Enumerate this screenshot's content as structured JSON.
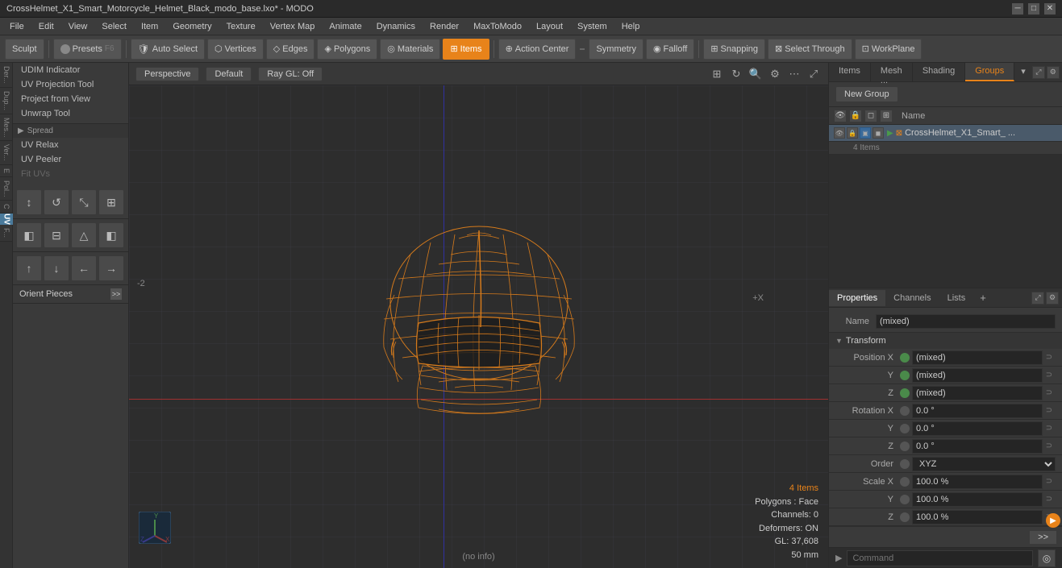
{
  "titlebar": {
    "title": "CrossHelmet_X1_Smart_Motorcycle_Helmet_Black_modo_base.lxo* - MODO",
    "controls": [
      "─",
      "□",
      "✕"
    ]
  },
  "menubar": {
    "items": [
      "File",
      "Edit",
      "View",
      "Select",
      "Item",
      "Geometry",
      "Texture",
      "Vertex Map",
      "Animate",
      "Dynamics",
      "Render",
      "MaxToModo",
      "Layout",
      "System",
      "Help"
    ]
  },
  "toolbar": {
    "sculpt_label": "Sculpt",
    "presets_label": "Presets",
    "presets_key": "F6",
    "auto_select_label": "Auto Select",
    "vertices_label": "Vertices",
    "edges_label": "Edges",
    "polygons_label": "Polygons",
    "materials_label": "Materials",
    "items_label": "Items",
    "action_center_label": "Action Center",
    "symmetry_label": "Symmetry",
    "falloff_label": "Falloff",
    "snapping_label": "Snapping",
    "select_through_label": "Select Through",
    "workplane_label": "WorkPlane"
  },
  "left_sidebar": {
    "tools": [
      "UDIM Indicator",
      "UV Projection Tool",
      "Project from View",
      "Unwrap Tool"
    ],
    "spread_label": "Spread",
    "relax_label": "UV Relax",
    "peeler_label": "UV Peeler",
    "fit_label": "Fit UVs",
    "orient_label": "Orient Pieces",
    "uv_mode": "UV",
    "vert_labels": [
      "Der...",
      "Dup...",
      "Mes...",
      "Vert...",
      "E",
      "Pol...",
      "C",
      "F..."
    ]
  },
  "viewport": {
    "perspective_label": "Perspective",
    "default_label": "Default",
    "ray_gl_label": "Ray GL: Off",
    "status_info": {
      "items_count": "4 Items",
      "polygons": "Polygons : Face",
      "channels": "Channels: 0",
      "deformers": "Deformers: ON",
      "gl": "GL: 37,608",
      "size": "50 mm"
    },
    "bottom_status": "(no info)",
    "crosshair": "+X"
  },
  "right_panel": {
    "tabs": [
      "Items",
      "Mesh ...",
      "Shading",
      "Groups"
    ],
    "active_tab": "Groups",
    "new_group_label": "New Group",
    "list_header": "Name",
    "group_item": {
      "name": "CrossHelmet_X1_Smart_ ...",
      "count": "4 Items"
    },
    "props_tabs": [
      "Properties",
      "Channels",
      "Lists"
    ],
    "props_add": "+",
    "name_label": "Name",
    "name_value": "(mixed)",
    "transform_section": "Transform",
    "fields": {
      "position_x_label": "Position X",
      "position_x_value": "(mixed)",
      "position_y_label": "Y",
      "position_y_value": "(mixed)",
      "position_z_label": "Z",
      "position_z_value": "(mixed)",
      "rotation_x_label": "Rotation X",
      "rotation_x_value": "0.0 °",
      "rotation_y_label": "Y",
      "rotation_y_value": "0.0 °",
      "rotation_z_label": "Z",
      "rotation_z_value": "0.0 °",
      "order_label": "Order",
      "order_value": "XYZ",
      "scale_x_label": "Scale X",
      "scale_x_value": "100.0 %",
      "scale_y_label": "Y",
      "scale_y_value": "100.0 %",
      "scale_z_label": "Z",
      "scale_z_value": "100.0 %"
    }
  },
  "command_bar": {
    "placeholder": "Command",
    "run_icon": "▶"
  }
}
